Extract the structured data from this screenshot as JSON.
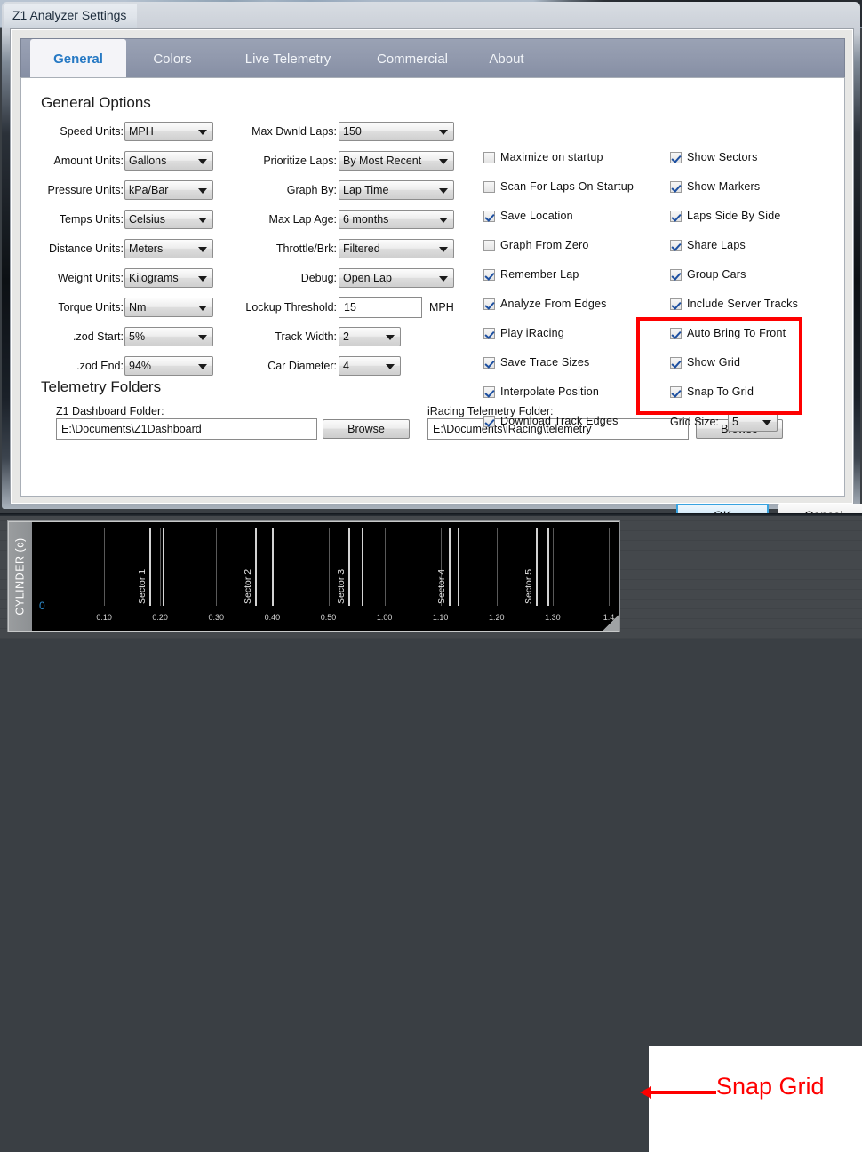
{
  "window": {
    "title": "Z1 Analyzer Settings"
  },
  "tabs": [
    {
      "label": "General",
      "active": true
    },
    {
      "label": "Colors",
      "active": false
    },
    {
      "label": "Live Telemetry",
      "active": false
    },
    {
      "label": "Commercial",
      "active": false
    },
    {
      "label": "About",
      "active": false
    }
  ],
  "general": {
    "section_title": "General Options",
    "left_fields": [
      {
        "label": "Speed Units:",
        "value": "MPH"
      },
      {
        "label": "Amount Units:",
        "value": "Gallons"
      },
      {
        "label": "Pressure Units:",
        "value": "kPa/Bar"
      },
      {
        "label": "Temps Units:",
        "value": "Celsius"
      },
      {
        "label": "Distance Units:",
        "value": "Meters"
      },
      {
        "label": "Weight Units:",
        "value": "Kilograms"
      },
      {
        "label": "Torque Units:",
        "value": "Nm"
      },
      {
        "label": ".zod Start:",
        "value": "5%"
      },
      {
        "label": ".zod End:",
        "value": "94%"
      }
    ],
    "mid_fields": [
      {
        "label": "Max Dwnld Laps:",
        "value": "150",
        "type": "combo"
      },
      {
        "label": "Prioritize Laps:",
        "value": "By Most Recent",
        "type": "combo"
      },
      {
        "label": "Graph By:",
        "value": "Lap Time",
        "type": "combo"
      },
      {
        "label": "Max Lap Age:",
        "value": "6 months",
        "type": "combo"
      },
      {
        "label": "Throttle/Brk:",
        "value": "Filtered",
        "type": "combo"
      },
      {
        "label": "Debug:",
        "value": "Open Lap",
        "type": "combo"
      },
      {
        "label": "Lockup Threshold:",
        "value": "15",
        "type": "text",
        "unit": "MPH"
      },
      {
        "label": "Track Width:",
        "value": "2",
        "type": "combo-small"
      },
      {
        "label": "Car Diameter:",
        "value": "4",
        "type": "combo-small"
      }
    ],
    "checkbox_col1": [
      {
        "label": "Maximize on startup",
        "checked": false
      },
      {
        "label": "Scan For Laps On Startup",
        "checked": false
      },
      {
        "label": "Save Location",
        "checked": true
      },
      {
        "label": "Graph From Zero",
        "checked": false
      },
      {
        "label": "Remember Lap",
        "checked": true
      },
      {
        "label": "Analyze From Edges",
        "checked": true
      },
      {
        "label": "Play iRacing",
        "checked": true
      },
      {
        "label": "Save Trace Sizes",
        "checked": true
      },
      {
        "label": "Interpolate Position",
        "checked": true
      },
      {
        "label": "Download Track Edges",
        "checked": true
      }
    ],
    "checkbox_col2": [
      {
        "label": "Show Sectors",
        "checked": true
      },
      {
        "label": "Show Markers",
        "checked": true
      },
      {
        "label": "Laps Side By Side",
        "checked": true
      },
      {
        "label": "Share Laps",
        "checked": true
      },
      {
        "label": "Group Cars",
        "checked": true
      },
      {
        "label": "Include Server Tracks",
        "checked": true
      },
      {
        "label": "Auto Bring To Front",
        "checked": true
      },
      {
        "label": "Show Grid",
        "checked": true
      },
      {
        "label": "Snap To Grid",
        "checked": true
      }
    ],
    "grid_size": {
      "label": "Grid Size:",
      "value": "5"
    }
  },
  "telemetry_folders": {
    "section_title": "Telemetry Folders",
    "z1_label": "Z1 Dashboard Folder:",
    "z1_value": "E:\\Documents\\Z1Dashboard",
    "z1_browse": "Browse",
    "iracing_label": "iRacing Telemetry Folder:",
    "iracing_value": "E:\\Documents\\iRacing\\telemetry",
    "iracing_browse": "Browse"
  },
  "footer": {
    "ok_label": "OK",
    "cancel_label": "Cancel"
  },
  "telemetry_graph": {
    "y_axis_label": "CYLINDER (c)",
    "zero_label": "0",
    "time_ticks": [
      "0:10",
      "0:20",
      "0:30",
      "0:40",
      "0:50",
      "1:00",
      "1:10",
      "1:20",
      "1:30",
      "1:4"
    ],
    "sectors": [
      "Sector 1",
      "Sector 2",
      "Sector 3",
      "Sector 4",
      "Sector 5"
    ]
  },
  "annotation": {
    "text": "Snap Grid",
    "color": "#fe0000"
  },
  "colors": {
    "accent": "#2679c4",
    "highlight": "#fe0000",
    "tab_strip": "#9199ad",
    "trace": "#2f79ad"
  }
}
